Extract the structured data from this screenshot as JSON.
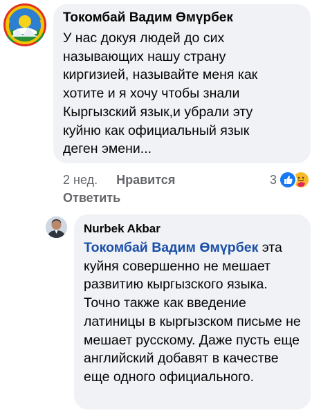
{
  "comment_1": {
    "author": "Токомбай Вадим Өмүрбек",
    "text": "У нас докуя людей до сих\nназывающих нашу страну\nкиргизией, называйте меня как\nхотите и я хочу чтобы знали\nКыргызский язык,и убрали эту\nкуйню как официальный язык\nдеген эмени...",
    "time": "2 нед.",
    "like_label": "Нравится",
    "reply_label": "Ответить",
    "reaction_count": "3",
    "reaction_icons": [
      "like-icon",
      "care-icon"
    ],
    "avatar_icon": "kyrgyz-emblem-icon"
  },
  "reply_1": {
    "author": "Nurbek Akbar",
    "mention": "Токомбай Вадим Өмүрбек",
    "text_after_mention": " эта куйня совершенно не мешает развитию кыргызского языка. Точно также как введение латиницы в кыргызском письме не мешает русскому. Даже пусть еще английский добавят в качестве еще одного официального.",
    "avatar_icon": "user-photo-avatar"
  },
  "colors": {
    "bubble": "#f0f2f5",
    "mention": "#1a4fa8",
    "meta": "#65676b",
    "like_blue": "#1877f2",
    "care_yellow": "#f7b928"
  }
}
